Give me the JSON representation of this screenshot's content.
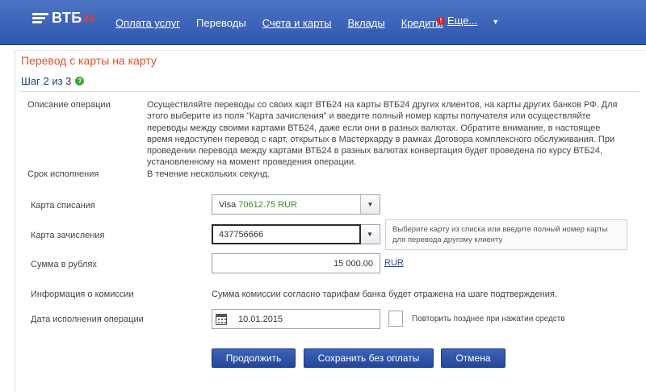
{
  "brand": {
    "name": "ВТБ",
    "accent": "24"
  },
  "nav": {
    "items": [
      {
        "label": "Оплата услуг",
        "underline": true
      },
      {
        "label": "Переводы",
        "underline": false
      },
      {
        "label": "Счета и карты",
        "underline": true
      },
      {
        "label": "Вклады",
        "underline": true
      },
      {
        "label": "Кредиты",
        "underline": true
      }
    ],
    "more_label": "Еще...",
    "badge": "!"
  },
  "page": {
    "title": "Перевод с карты на карту",
    "step": "Шаг 2 из 3",
    "step_help": "?"
  },
  "form": {
    "description_label": "Описание операции",
    "description_text": "Осуществляйте переводы со своих карт ВТБ24 на карты ВТБ24 других клиентов, на карты других банков РФ. Для этого выберите из поля \"Карта зачисления\" и введите полный номер карты получателя или осуществляйте переводы между своими картами ВТБ24, даже если они в разных валютах. Обратите внимание, в настоящее время недоступен перевод с карт, открытых в Мастеркарду в рамках Договора комплексного обслуживания. При проведении перевода между картами ВТБ24 в разных валютах конвертация будет проведена по курсу ВТБ24, установленному на момент проведения операции.",
    "term_label": "Срок исполнения",
    "term_value": "В течение нескольких секунд.",
    "debit_card_label": "Карта списания",
    "debit_card_value_prefix": "Visa",
    "debit_card_amount": "70612.75 RUR",
    "credit_card_label": "Карта зачисления",
    "credit_card_value": "437756666",
    "hint": "Выберите карту из списка или введите полный номер карты для перевода другому клиенту",
    "amount_label": "Сумма в рублях",
    "amount_value": "15 000.00",
    "currency": "RUR",
    "commission_label": "Информация о комиссии",
    "commission_value": "Сумма комиссии согласно тарифам банка будет отражена на шаге подтверждения.",
    "date_label": "Дата исполнения операции",
    "date_value": "10.01.2015",
    "repeat_label": "Повторить позднее при нажатии средств"
  },
  "buttons": {
    "continue": "Продолжить",
    "save_unpaid": "Сохранить без оплаты",
    "cancel": "Отмена"
  },
  "colors": {
    "header": "#3a62b8",
    "title": "#e0502c",
    "button": "#2f54a8",
    "amount": "#3d8c2a"
  }
}
